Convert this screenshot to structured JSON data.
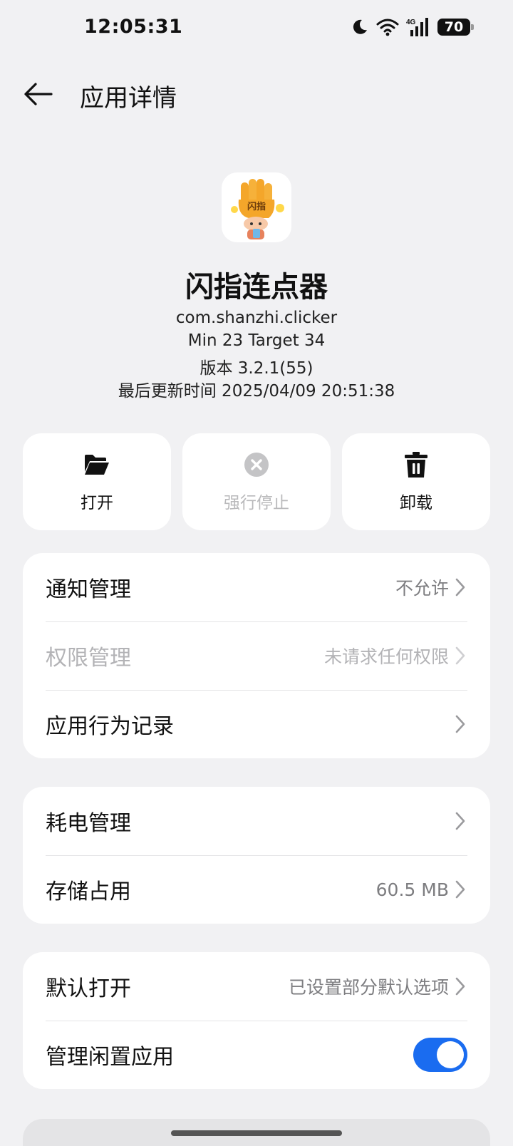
{
  "status_bar": {
    "time": "12:05:31",
    "battery": "70",
    "network": "4G",
    "icons": [
      "moon-icon",
      "wifi-icon",
      "cellular-4g-icon",
      "battery-icon"
    ]
  },
  "header": {
    "title": "应用详情",
    "back_icon": "back-arrow-icon"
  },
  "app": {
    "name": "闪指连点器",
    "package": "com.shanzhi.clicker",
    "sdk": "Min 23 Target 34",
    "version": "版本 3.2.1(55)",
    "updated": "最后更新时间 2025/04/09 20:51:38",
    "icon_text": "闪指"
  },
  "actions": [
    {
      "label": "打开",
      "icon": "folder-open-icon",
      "enabled": true
    },
    {
      "label": "强行停止",
      "icon": "force-stop-icon",
      "enabled": false
    },
    {
      "label": "卸载",
      "icon": "trash-icon",
      "enabled": true
    }
  ],
  "card1": {
    "rows": [
      {
        "label": "通知管理",
        "value": "不允许",
        "enabled": true
      },
      {
        "label": "权限管理",
        "value": "未请求任何权限",
        "enabled": false
      },
      {
        "label": "应用行为记录",
        "value": "",
        "enabled": true
      }
    ]
  },
  "card2": {
    "rows": [
      {
        "label": "耗电管理",
        "value": ""
      },
      {
        "label": "存储占用",
        "value": "60.5 MB"
      }
    ]
  },
  "card3": {
    "rows": [
      {
        "label": "默认打开",
        "value": "已设置部分默认选项"
      },
      {
        "label": "管理闲置应用",
        "toggle_on": true
      }
    ]
  },
  "colors": {
    "accent": "#1a6cf0",
    "background": "#f1f1f3",
    "card": "#ffffff",
    "secondary_text": "#7d7d80",
    "disabled_text": "#b3b3b6"
  }
}
